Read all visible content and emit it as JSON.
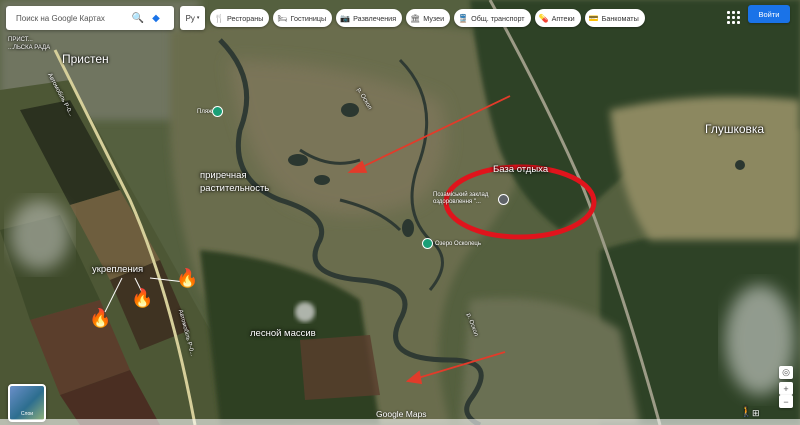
{
  "search": {
    "placeholder": "Поиск на Google Картах",
    "language": "Ру"
  },
  "categories": [
    {
      "label": "Рестораны",
      "icon": "restaurant-icon",
      "glyph": "🍴"
    },
    {
      "label": "Гостиницы",
      "icon": "hotel-icon",
      "glyph": "🛏"
    },
    {
      "label": "Развлечения",
      "icon": "camera-icon",
      "glyph": "📷"
    },
    {
      "label": "Музеи",
      "icon": "museum-icon",
      "glyph": "🏛"
    },
    {
      "label": "Общ. транспорт",
      "icon": "transit-icon",
      "glyph": "🚆"
    },
    {
      "label": "Аптеки",
      "icon": "pharmacy-icon",
      "glyph": "💊"
    },
    {
      "label": "Банкоматы",
      "icon": "atm-icon",
      "glyph": "💳"
    }
  ],
  "signin_label": "Войти",
  "places": {
    "pristen": "Пристен",
    "glushkovka": "Глушковка",
    "top_left_small": "ПРИСТ...",
    "council_small": "...ЛЬСКА РАДА",
    "river_oskol": "р. Оскол",
    "river_oskol2": "р. Оскол",
    "road1": "Автомобіль Р-0...",
    "road2": "Автомобіль Р-0..."
  },
  "pois": {
    "beach": "Пляж",
    "camp": "Позаміський заклад оздоровлення \"...",
    "lake": "Озеро Осколець"
  },
  "annotations": {
    "base": "База отдыха",
    "vegetation": "приречная растительность",
    "fortifications": "укрепления",
    "forest": "лесной массив"
  },
  "bottom": {
    "layers_label": "Слои",
    "logo": "Google Maps"
  },
  "colors": {
    "annotation_ring": "#e0141c",
    "arrow": "#e23b2a",
    "signin": "#1a73e8",
    "poi_pin": "#1a9e76"
  }
}
